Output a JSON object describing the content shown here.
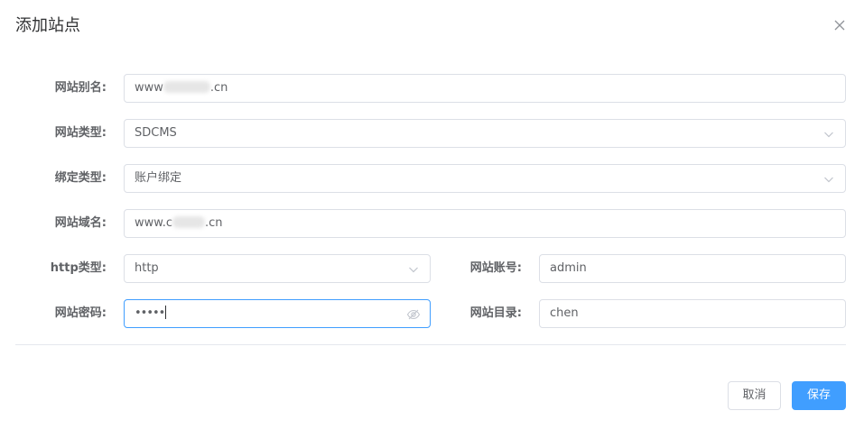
{
  "dialog": {
    "title": "添加站点",
    "close_icon": "close-icon"
  },
  "form": {
    "alias": {
      "label": "网站别名:",
      "value_prefix": "www",
      "value_suffix": ".cn"
    },
    "site_type": {
      "label": "网站类型:",
      "value": "SDCMS",
      "icon": "chevron-down-icon"
    },
    "bind_type": {
      "label": "绑定类型:",
      "value": "账户绑定",
      "icon": "chevron-down-icon"
    },
    "domain": {
      "label": "网站域名:",
      "value_prefix": "www.c",
      "value_suffix": ".cn"
    },
    "http_type": {
      "label": "http类型:",
      "value": "http",
      "icon": "chevron-down-icon"
    },
    "account": {
      "label": "网站账号:",
      "value": "admin"
    },
    "password": {
      "label": "网站密码:",
      "value": "•••••",
      "icon": "eye-off-icon"
    },
    "directory": {
      "label": "网站目录:",
      "value": "chen"
    }
  },
  "footer": {
    "cancel_label": "取消",
    "save_label": "保存"
  },
  "colors": {
    "primary": "#409eff",
    "border": "#dcdfe6",
    "text": "#606266"
  }
}
